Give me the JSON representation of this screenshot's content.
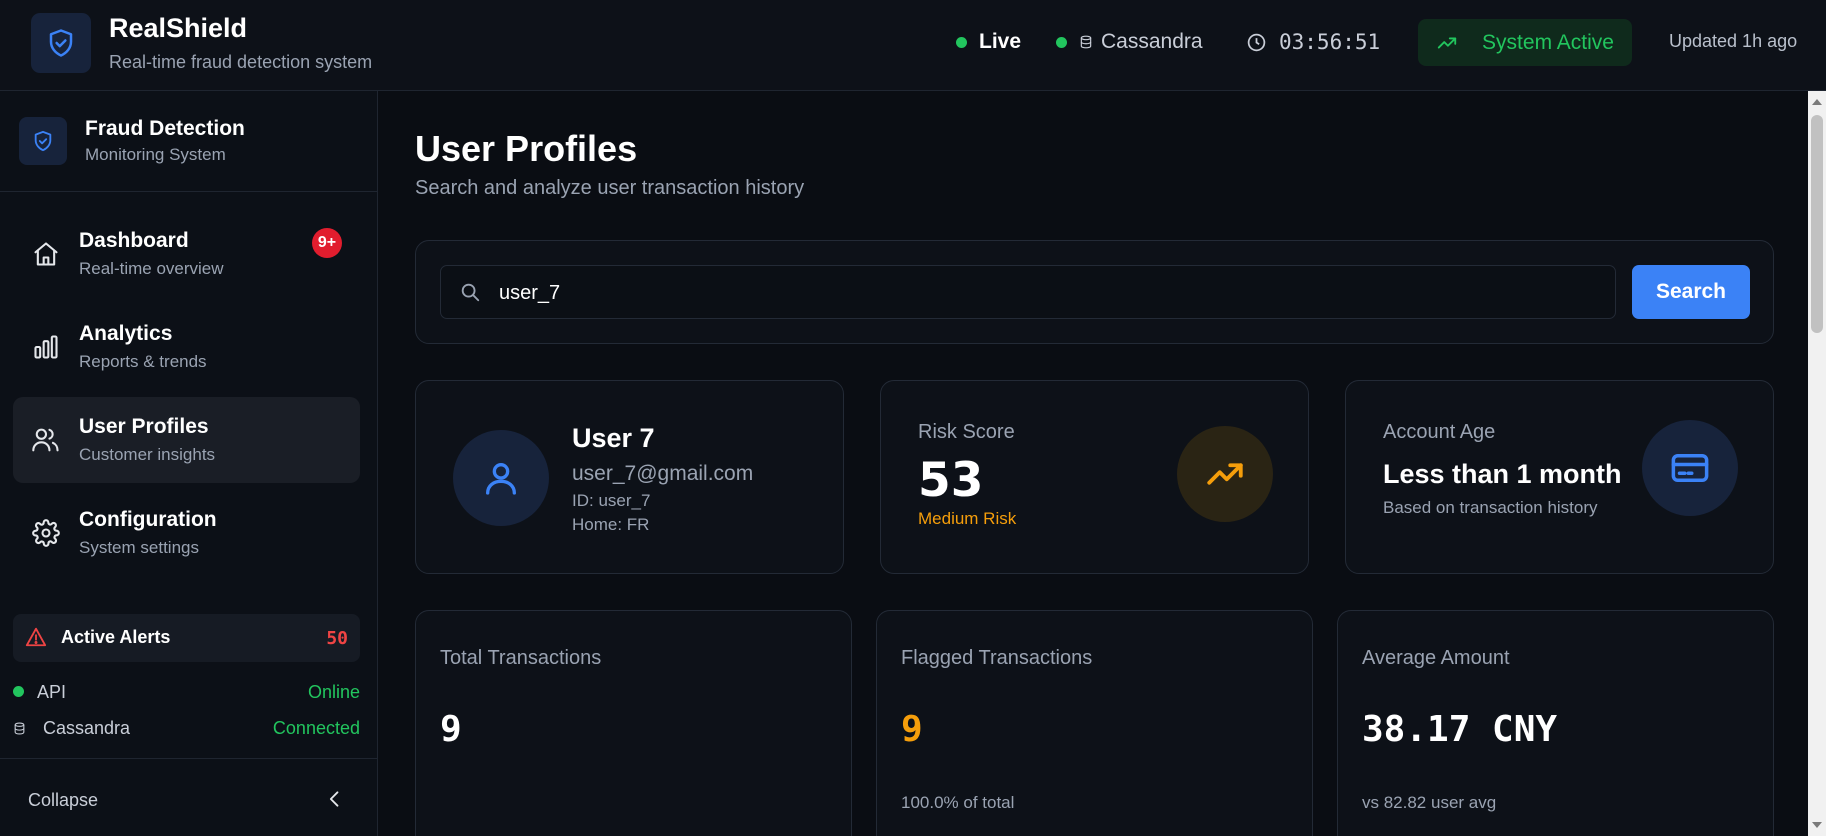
{
  "header": {
    "brand_title": "RealShield",
    "brand_subtitle": "Real-time fraud detection system",
    "live_label": "Live",
    "db_label": "Cassandra",
    "clock": "03:56:51",
    "system_status": "System Active",
    "updated": "Updated 1h ago",
    "icons": [
      "shield-check-icon",
      "database-icon",
      "clock-icon",
      "trending-up-icon"
    ]
  },
  "sidebar": {
    "title": "Fraud Detection",
    "subtitle": "Monitoring System",
    "items": [
      {
        "label": "Dashboard",
        "desc": "Real-time overview",
        "icon": "home-icon",
        "badge": "9+",
        "active": false
      },
      {
        "label": "Analytics",
        "desc": "Reports & trends",
        "icon": "bar-chart-icon",
        "active": false
      },
      {
        "label": "User Profiles",
        "desc": "Customer insights",
        "icon": "users-icon",
        "active": true
      },
      {
        "label": "Configuration",
        "desc": "System settings",
        "icon": "gear-icon",
        "active": false
      }
    ],
    "alerts": {
      "label": "Active Alerts",
      "count": "50"
    },
    "status": [
      {
        "name": "API",
        "value": "Online"
      },
      {
        "name": "Cassandra",
        "value": "Connected"
      }
    ],
    "collapse_label": "Collapse"
  },
  "main": {
    "title": "User Profiles",
    "subtitle": "Search and analyze user transaction history",
    "search": {
      "value": "user_7",
      "button": "Search"
    },
    "user": {
      "name": "User 7",
      "email": "user_7@gmail.com",
      "id": "ID: user_7",
      "home": "Home: FR"
    },
    "risk": {
      "label": "Risk Score",
      "value": "53",
      "level": "Medium Risk"
    },
    "account_age": {
      "label": "Account Age",
      "value": "Less than 1 month",
      "note": "Based on transaction history"
    },
    "stats": [
      {
        "label": "Total Transactions",
        "value": "9",
        "note": ""
      },
      {
        "label": "Flagged Transactions",
        "value": "9",
        "note": "100.0% of total"
      },
      {
        "label": "Average Amount",
        "value": "38.17 CNY",
        "note": "vs 82.82 user avg"
      }
    ]
  },
  "colors": {
    "accent": "#3b82f6",
    "success": "#22c55e",
    "warning": "#f59e0b",
    "danger": "#ef4444",
    "background": "#0a0d13"
  }
}
